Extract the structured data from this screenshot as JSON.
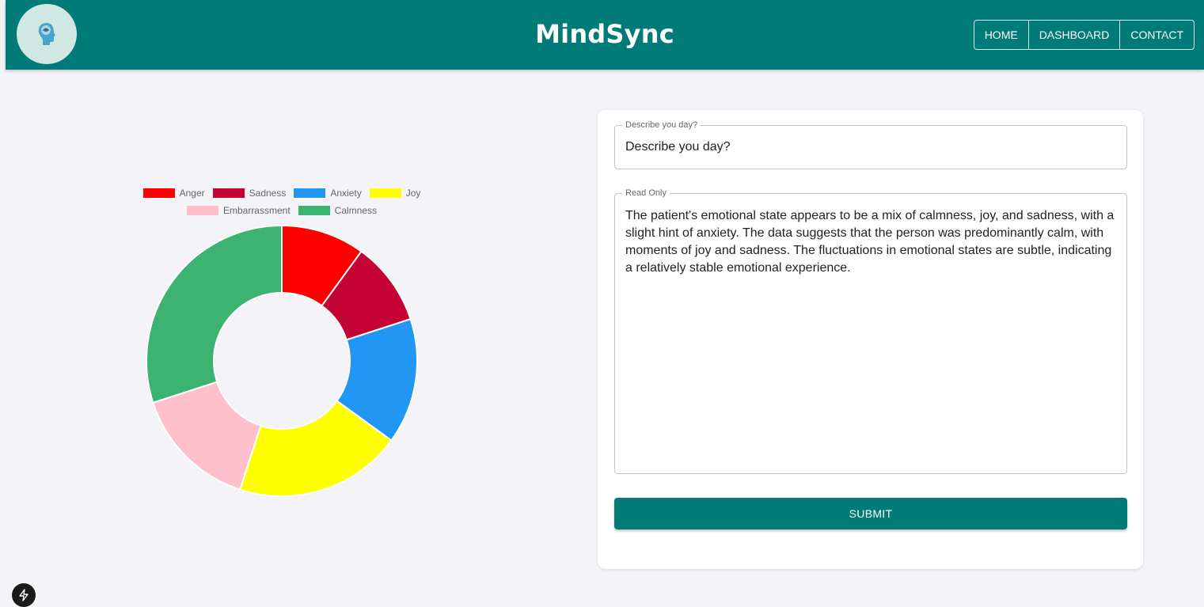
{
  "app": {
    "title": "MindSync",
    "logo_icon": "head-brain-icon"
  },
  "nav": {
    "items": [
      "HOME",
      "DASHBOARD",
      "CONTACT"
    ]
  },
  "form": {
    "describe": {
      "label": "Describe you day?",
      "value": "Describe you day?"
    },
    "readonly": {
      "label": "Read Only",
      "value": "The patient's emotional state appears to be a mix of calmness, joy, and sadness, with a slight hint of anxiety. The data suggests that the person was predominantly calm, with moments of joy and sadness. The fluctuations in emotional states are subtle, indicating a relatively stable emotional experience."
    },
    "submit_label": "SUBMIT"
  },
  "colors": {
    "accent": "#007b78",
    "background": "#f3f3f8"
  },
  "chart_data": {
    "type": "doughnut",
    "categories": [
      "Anger",
      "Sadness",
      "Anxiety",
      "Joy",
      "Embarrassment",
      "Calmness"
    ],
    "values": [
      10,
      10,
      15,
      20,
      15,
      30
    ],
    "colors": [
      "#ff0000",
      "#c40233",
      "#2196f3",
      "#ffff00",
      "#ffc0cb",
      "#3cb371"
    ],
    "legend_position": "top"
  },
  "dev_indicator_icon": "lightning-icon"
}
